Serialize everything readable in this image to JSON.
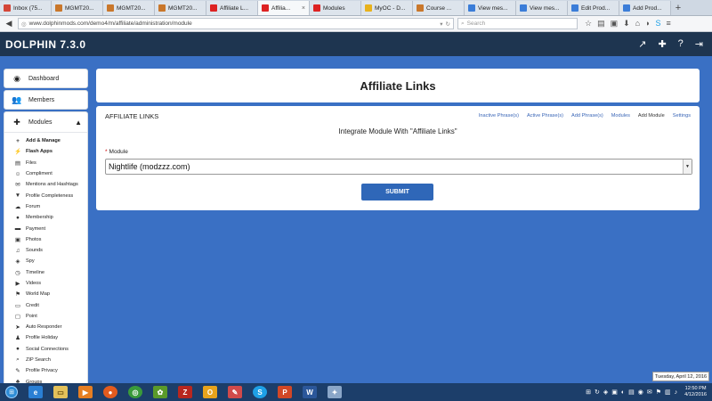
{
  "browser": {
    "tabs": [
      {
        "label": "Inbox (75...",
        "color": "#d44638",
        "active": false
      },
      {
        "label": "MGMT20...",
        "color": "#c9772b",
        "active": false
      },
      {
        "label": "MGMT20...",
        "color": "#c9772b",
        "active": false
      },
      {
        "label": "MGMT20...",
        "color": "#c9772b",
        "active": false
      },
      {
        "label": "Affiliate L...",
        "color": "#d22",
        "active": false
      },
      {
        "label": "Affilia...",
        "color": "#d22",
        "active": true
      },
      {
        "label": "Modules",
        "color": "#d22",
        "active": false
      },
      {
        "label": "MyOC - D...",
        "color": "#e8b21c",
        "active": false
      },
      {
        "label": "Course ...",
        "color": "#c9772b",
        "active": false
      },
      {
        "label": "View mes...",
        "color": "#3b7dd8",
        "active": false
      },
      {
        "label": "View mes...",
        "color": "#3b7dd8",
        "active": false
      },
      {
        "label": "Edit Prod...",
        "color": "#3b7dd8",
        "active": false
      },
      {
        "label": "Add Prod...",
        "color": "#3b7dd8",
        "active": false
      }
    ],
    "url": "www.dolphinmods.com/demo4/m/affiliate/administration/module",
    "search_placeholder": "Search"
  },
  "site": {
    "brand": "DOLPHIN 7.3.0"
  },
  "sidebar": {
    "dashboard": "Dashboard",
    "members": "Members",
    "modules": "Modules",
    "items": [
      {
        "label": "Add & Manage",
        "icon": "+",
        "bold": true
      },
      {
        "label": "Flash Apps",
        "icon": "⚡",
        "bold": true
      },
      {
        "label": "Files",
        "icon": "▤",
        "bold": false
      },
      {
        "label": "Compliment",
        "icon": "☺",
        "bold": false
      },
      {
        "label": "Mentions and Hashtags",
        "icon": "✉",
        "bold": false
      },
      {
        "label": "Profile Completeness",
        "icon": "▼",
        "bold": false
      },
      {
        "label": "Forum",
        "icon": "☁",
        "bold": false
      },
      {
        "label": "Membership",
        "icon": "●",
        "bold": false
      },
      {
        "label": "Payment",
        "icon": "▬",
        "bold": false
      },
      {
        "label": "Photos",
        "icon": "▣",
        "bold": false
      },
      {
        "label": "Sounds",
        "icon": "♫",
        "bold": false
      },
      {
        "label": "Spy",
        "icon": "◈",
        "bold": false
      },
      {
        "label": "Timeline",
        "icon": "◷",
        "bold": false
      },
      {
        "label": "Videos",
        "icon": "▶",
        "bold": false
      },
      {
        "label": "World Map",
        "icon": "⚑",
        "bold": false
      },
      {
        "label": "Credit",
        "icon": "▭",
        "bold": false
      },
      {
        "label": "Point",
        "icon": "▢",
        "bold": false
      },
      {
        "label": "Auto Responder",
        "icon": "➤",
        "bold": false
      },
      {
        "label": "Profile Holiday",
        "icon": "♟",
        "bold": false
      },
      {
        "label": "Social Connections",
        "icon": "●",
        "bold": false
      },
      {
        "label": "ZIP Search",
        "icon": "⌕",
        "bold": false
      },
      {
        "label": "Profile Privacy",
        "icon": "✎",
        "bold": false
      },
      {
        "label": "Groups",
        "icon": "♣",
        "bold": false
      }
    ]
  },
  "main": {
    "title": "Affiliate Links",
    "card_header": "AFFILIATE LINKS",
    "links": [
      {
        "label": "Inactive Phrase(s)",
        "current": false
      },
      {
        "label": "Active Phrase(s)",
        "current": false
      },
      {
        "label": "Add Phrase(s)",
        "current": false
      },
      {
        "label": "Modules",
        "current": false
      },
      {
        "label": "Add Module",
        "current": true
      },
      {
        "label": "Settings",
        "current": false
      }
    ],
    "integrate_title": "Integrate Module With \"Affiliate Links\"",
    "module_label": "Module",
    "module_required": "*",
    "module_value": "Nightlife (modzzz.com)",
    "submit_label": "SUBMIT"
  },
  "tooltip": "Tuesday, April 12, 2016",
  "taskbar": {
    "time": "12:50 PM",
    "date": "4/12/2016"
  }
}
